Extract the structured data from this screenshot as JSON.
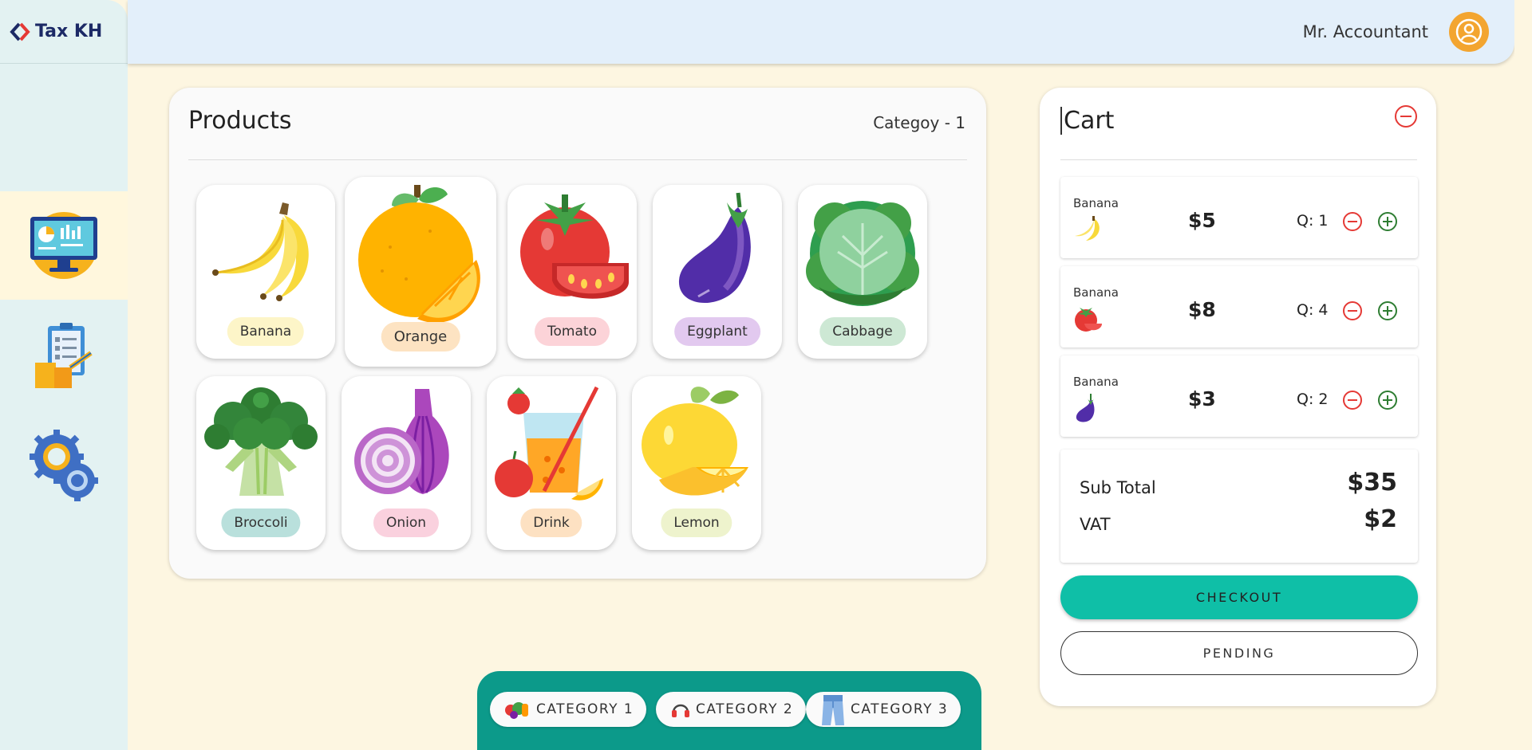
{
  "brand": {
    "name": "Tax KH"
  },
  "topbar": {
    "user_name": "Mr. Accountant"
  },
  "sidebar": {
    "items": [
      {
        "name": "dashboard",
        "icon": "monitor-chart-icon",
        "active": true
      },
      {
        "name": "reports",
        "icon": "clipboard-boxes-icon",
        "active": false
      },
      {
        "name": "settings",
        "icon": "gears-icon",
        "active": false
      }
    ]
  },
  "products": {
    "title": "Products",
    "category_label": "Categoy - 1",
    "items": [
      {
        "label": "Banana",
        "icon": "banana-icon",
        "pill_color": "#fdf5c8"
      },
      {
        "label": "Orange",
        "icon": "orange-icon",
        "pill_color": "#fde3c2"
      },
      {
        "label": "Tomato",
        "icon": "tomato-icon",
        "pill_color": "#fcd3d8"
      },
      {
        "label": "Eggplant",
        "icon": "eggplant-icon",
        "pill_color": "#e2c9ef"
      },
      {
        "label": "Cabbage",
        "icon": "cabbage-icon",
        "pill_color": "#cde8d4"
      },
      {
        "label": "Broccoli",
        "icon": "broccoli-icon",
        "pill_color": "#b9e0dc"
      },
      {
        "label": "Onion",
        "icon": "onion-icon",
        "pill_color": "#fad1de"
      },
      {
        "label": "Drink",
        "icon": "drink-icon",
        "pill_color": "#fde1c2"
      },
      {
        "label": "Lemon",
        "icon": "lemon-icon",
        "pill_color": "#eef3cd"
      }
    ]
  },
  "categories": [
    {
      "label": "CATEGORY 1",
      "icon": "vegetables-icon"
    },
    {
      "label": "CATEGORY 2",
      "icon": "headphones-icon"
    },
    {
      "label": "CATEGORY 3",
      "icon": "jeans-icon"
    }
  ],
  "cart": {
    "title": "Cart",
    "items": [
      {
        "name": "Banana",
        "icon": "banana-icon",
        "price": "$5",
        "qty": "Q: 1"
      },
      {
        "name": "Banana",
        "icon": "tomato-icon",
        "price": "$8",
        "qty": "Q: 4"
      },
      {
        "name": "Banana",
        "icon": "eggplant-icon",
        "price": "$3",
        "qty": "Q: 2"
      }
    ],
    "subtotal_label": "Sub Total",
    "subtotal_value": "$35",
    "vat_label": "VAT",
    "vat_value": "$2",
    "checkout_label": "CHECKOUT",
    "pending_label": "PENDING"
  },
  "colors": {
    "accent": "#0fbfa7",
    "category_bar": "#0c9a8a",
    "minus": "#e53935",
    "plus": "#2e7d32",
    "brand_blue": "#1c2a66"
  }
}
